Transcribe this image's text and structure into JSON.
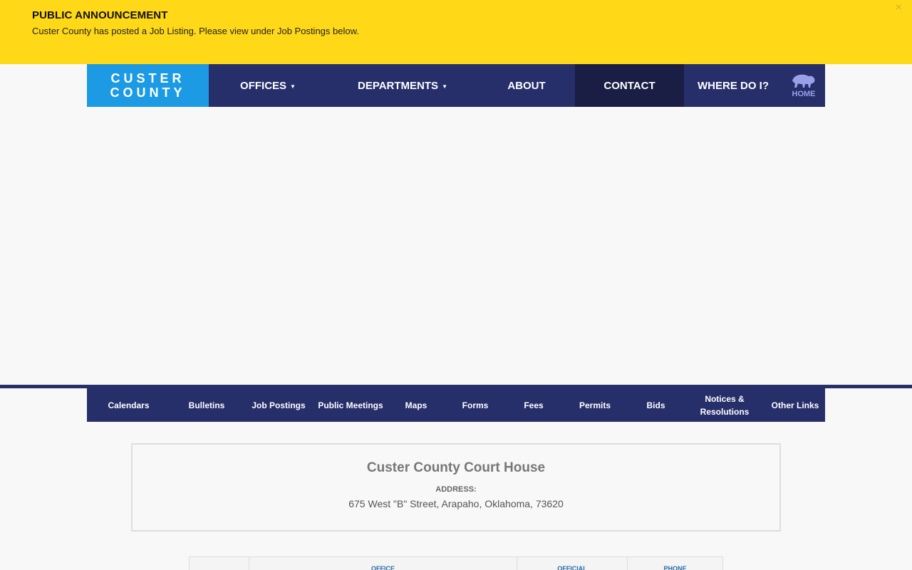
{
  "announcement": {
    "title": "PUBLIC ANNOUNCEMENT",
    "message": "Custer County has posted a Job Listing. Please view under Job Postings below.",
    "close": "×"
  },
  "nav": {
    "logo_line1": "CUSTER",
    "logo_line2": "COUNTY",
    "items": [
      {
        "label": "OFFICES",
        "dropdown": true
      },
      {
        "label": "DEPARTMENTS",
        "dropdown": true
      },
      {
        "label": "ABOUT",
        "dropdown": false
      },
      {
        "label": "CONTACT",
        "dropdown": false,
        "active": true
      },
      {
        "label": "WHERE DO I?",
        "dropdown": false
      }
    ],
    "home_label": "HOME",
    "home_icon": "bison-icon",
    "caret": "▼"
  },
  "quick_links": [
    "Calendars",
    "Bulletins",
    "Job Postings",
    "Public Meetings",
    "Maps",
    "Forms",
    "Fees",
    "Permits",
    "Bids",
    "Notices & Resolutions",
    "Other Links"
  ],
  "courthouse": {
    "name": "Custer County Court House",
    "address_label": "ADDRESS:",
    "address": "675 West \"B\" Street, Arapaho, Oklahoma, 73620"
  },
  "directory": {
    "headers": [
      "",
      "OFFICE",
      "OFFICIAL",
      "PHONE"
    ]
  },
  "colors": {
    "announcement_bg": "#ffd817",
    "nav_bg": "#262f6a",
    "logo_bg": "#1c9ae4",
    "active_bg": "#1a1e45"
  }
}
